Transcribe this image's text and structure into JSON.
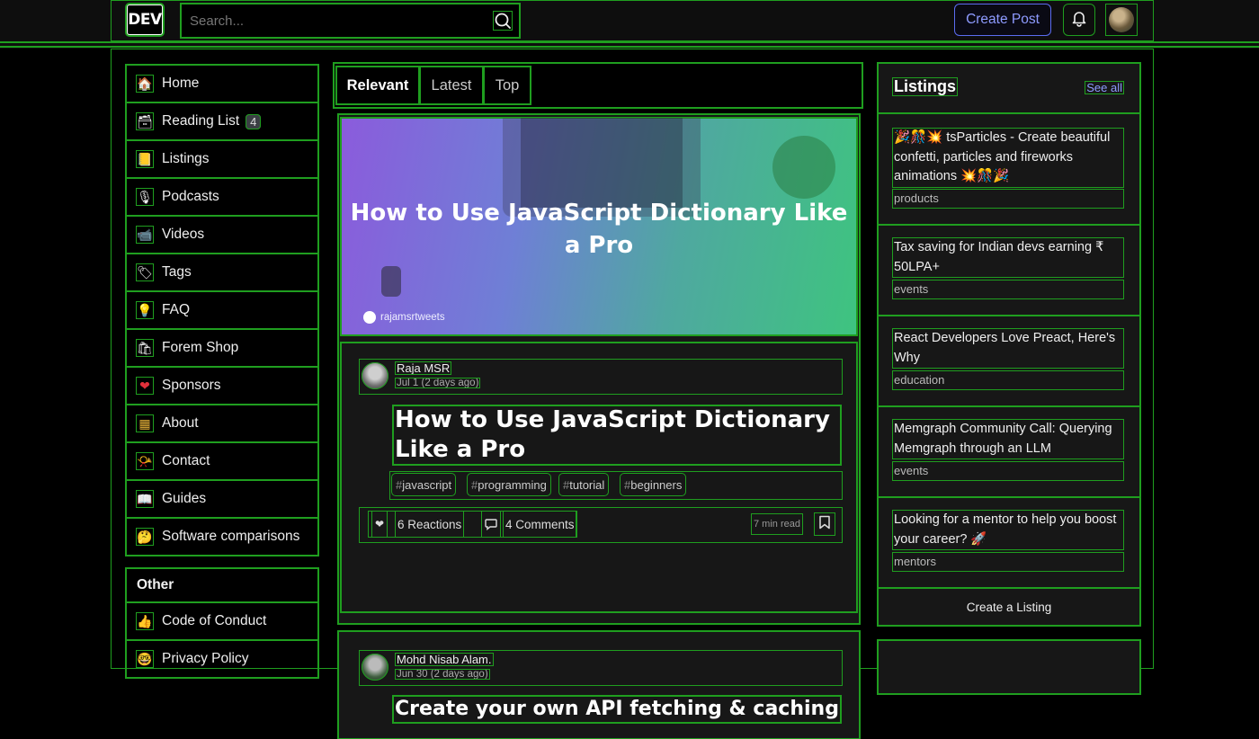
{
  "header": {
    "logo": "DEV",
    "search_placeholder": "Search...",
    "create_post": "Create Post"
  },
  "sidebar": {
    "items": [
      {
        "label": "Home",
        "icon": "house-icon",
        "glyph": "🏠"
      },
      {
        "label": "Reading List",
        "icon": "reading-list-icon",
        "glyph": "🗃",
        "badge": "4"
      },
      {
        "label": "Listings",
        "icon": "listings-icon",
        "glyph": "📒"
      },
      {
        "label": "Podcasts",
        "icon": "microphone-icon",
        "glyph": "🎙"
      },
      {
        "label": "Videos",
        "icon": "video-camera-icon",
        "glyph": "📹"
      },
      {
        "label": "Tags",
        "icon": "tag-icon",
        "glyph": "🏷"
      },
      {
        "label": "FAQ",
        "icon": "lightbulb-icon",
        "glyph": "💡"
      },
      {
        "label": "Forem Shop",
        "icon": "shopping-bags-icon",
        "glyph": "🛍"
      },
      {
        "label": "Sponsors",
        "icon": "heart-icon",
        "glyph": "❤"
      },
      {
        "label": "About",
        "icon": "dev-rainbow-icon",
        "glyph": "▦"
      },
      {
        "label": "Contact",
        "icon": "postal-horn-icon",
        "glyph": "📯"
      },
      {
        "label": "Guides",
        "icon": "book-icon",
        "glyph": "📖"
      },
      {
        "label": "Software comparisons",
        "icon": "thinking-face-icon",
        "glyph": "🤔"
      }
    ],
    "other_heading": "Other",
    "other_items": [
      {
        "label": "Code of Conduct",
        "icon": "thumbs-up-icon",
        "glyph": "👍"
      },
      {
        "label": "Privacy Policy",
        "icon": "nerd-face-icon",
        "glyph": "🤓"
      }
    ]
  },
  "feed": {
    "tabs": [
      "Relevant",
      "Latest",
      "Top"
    ],
    "posts": [
      {
        "cover_title": "How to Use JavaScript Dictionary Like a Pro",
        "cover_handle": "rajamsrtweets",
        "author": "Raja MSR",
        "date": "Jul 1 (2 days ago)",
        "title": "How to Use JavaScript Dictionary Like a Pro",
        "tags": [
          "javascript",
          "programming",
          "tutorial",
          "beginners"
        ],
        "reactions": "6 Reactions",
        "comments": "4 Comments",
        "read_time": "7 min read"
      },
      {
        "author": "Mohd Nisab Alam.",
        "date": "Jun 30 (2 days ago)",
        "title": "Create your own API fetching & caching"
      }
    ]
  },
  "listings": {
    "title": "Listings",
    "see_all": "See all",
    "items": [
      {
        "title": "🎉🎊💥 tsParticles - Create beautiful confetti, particles and fireworks animations 💥🎊🎉",
        "category": "products"
      },
      {
        "title": "Tax saving for Indian devs earning ₹ 50LPA+",
        "category": "events"
      },
      {
        "title": "React Developers Love Preact, Here's Why",
        "category": "education"
      },
      {
        "title": "Memgraph Community Call: Querying Memgraph through an LLM",
        "category": "events"
      },
      {
        "title": "Looking for a mentor to help you boost your career? 🚀",
        "category": "mentors"
      }
    ],
    "create": "Create a Listing"
  },
  "colors": {
    "outline": "#1f9e1f",
    "accent": "#8e9bff",
    "card": "#171717"
  }
}
